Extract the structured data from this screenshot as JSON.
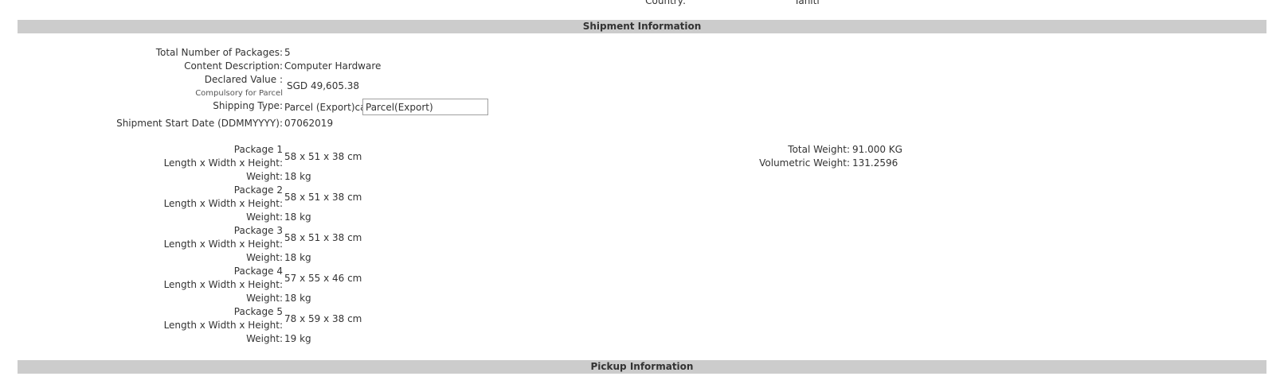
{
  "address_tail": {
    "country_label": "Country:",
    "country_value": "Tahiti"
  },
  "shipment_section": {
    "title": "Shipment Information",
    "total_packages_label": "Total Number of Packages:",
    "total_packages_value": "5",
    "content_description_label": "Content Description:",
    "content_description_value": "Computer Hardware",
    "declared_value_label": "Declared Value :",
    "declared_value_sublabel": "Compulsory for Parcel",
    "declared_value_value": "SGD 49,605.38",
    "shipping_type_label": "Shipping Type:",
    "shipping_type_text": "Parcel (Export)car",
    "shipping_type_input_value": "Parcel(Export)",
    "start_date_label": "Shipment Start Date (DDMMYYYY):",
    "start_date_value": "07062019",
    "packages": [
      {
        "title": "Package 1",
        "dims_label": "Length x Width x Height:",
        "dims": "58 x 51 x 38 cm",
        "weight_label": "Weight:",
        "weight": "18 kg"
      },
      {
        "title": "Package 2",
        "dims_label": "Length x Width x Height:",
        "dims": "58 x 51 x 38 cm",
        "weight_label": "Weight:",
        "weight": "18 kg"
      },
      {
        "title": "Package 3",
        "dims_label": "Length x Width x Height:",
        "dims": "58 x 51 x 38 cm",
        "weight_label": "Weight:",
        "weight": "18 kg"
      },
      {
        "title": "Package 4",
        "dims_label": "Length x Width x Height:",
        "dims": "57 x 55 x 46 cm",
        "weight_label": "Weight:",
        "weight": "18 kg"
      },
      {
        "title": "Package 5",
        "dims_label": "Length x Width x Height:",
        "dims": "78 x 59 x 38 cm",
        "weight_label": "Weight:",
        "weight": "19 kg"
      }
    ],
    "total_weight_label": "Total Weight:",
    "total_weight_value": "91.000 KG",
    "volumetric_weight_label": "Volumetric Weight:",
    "volumetric_weight_value": "131.2596"
  },
  "pickup_section": {
    "title": "Pickup Information"
  }
}
